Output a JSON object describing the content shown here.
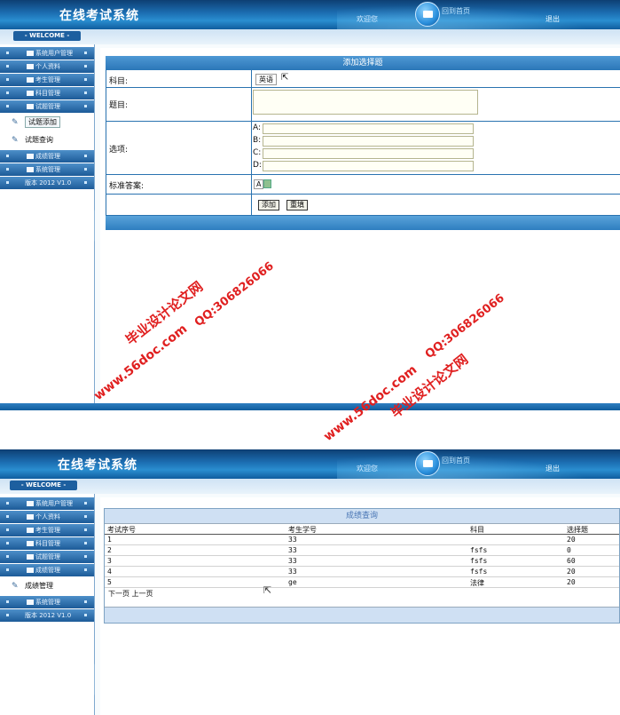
{
  "header": {
    "app_title": "在线考试系统",
    "link_a": "欢迎您",
    "link_b": "回到首页",
    "link_c": "退出",
    "welcome": "- WELCOME -"
  },
  "sidebar_top": {
    "items": [
      "系统用户管理",
      "个人资料",
      "考生管理",
      "科目管理",
      "试题管理"
    ],
    "sub_items": [
      "试题添加",
      "试题查询"
    ],
    "items_after": [
      "成绩管理",
      "系统管理"
    ],
    "version": "版本 2012 V1.0"
  },
  "add_form": {
    "title": "添加选择题",
    "subject_label": "科目:",
    "subject_value": "英语",
    "question_label": "题目:",
    "options_label": "选项:",
    "option_a": "A:",
    "option_b": "B:",
    "option_c": "C:",
    "option_d": "D:",
    "answer_label": "标准答案:",
    "answer_value": "A",
    "add_button": "添加",
    "reset_button": "重填"
  },
  "sidebar_bottom": {
    "items": [
      "系统用户管理",
      "个人资料",
      "考生管理",
      "科目管理",
      "试题管理",
      "成绩管理"
    ],
    "sub_items": [
      "成绩管理"
    ],
    "items_after": [
      "系统管理"
    ],
    "version": "版本 2012 V1.0"
  },
  "results": {
    "title": "成绩查询",
    "columns": [
      "考试序号",
      "考生学号",
      "科目",
      "选择题"
    ],
    "rows": [
      [
        "1",
        "33",
        "",
        "20"
      ],
      [
        "2",
        "33",
        "fsfs",
        "0"
      ],
      [
        "3",
        "33",
        "fsfs",
        "60"
      ],
      [
        "4",
        "33",
        "fsfs",
        "20"
      ],
      [
        "5",
        "ge",
        "法律",
        "20"
      ]
    ],
    "pager": "下一页 上一页"
  },
  "watermarks": {
    "site": "www.56doc.com",
    "brand": "毕业设计论文网",
    "qq": "QQ:306826066"
  }
}
